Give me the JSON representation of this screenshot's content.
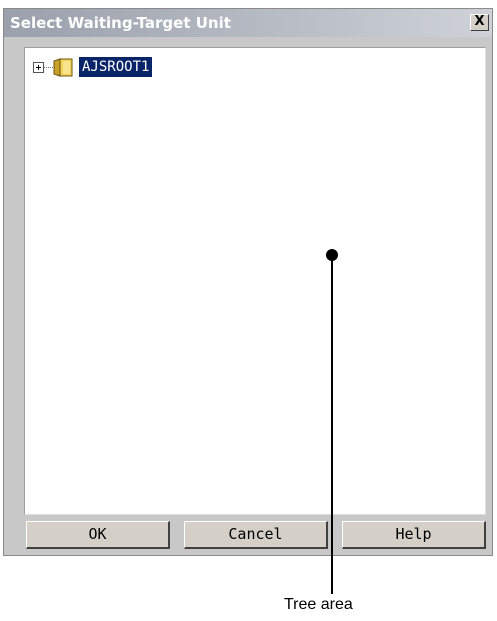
{
  "dialog": {
    "title": "Select Waiting-Target Unit",
    "close_label": "X"
  },
  "tree": {
    "nodes": [
      {
        "label": "AJSROOT1",
        "icon": "folder-icon",
        "expander": "plus",
        "selected": true
      }
    ]
  },
  "buttons": {
    "ok": "OK",
    "cancel": "Cancel",
    "help": "Help"
  },
  "annotation": {
    "label": "Tree area"
  },
  "colors": {
    "selection_bg": "#0a246a",
    "selection_text": "#ffffff",
    "dialog_bg": "#c8c8c8",
    "folder_yellow": "#e8c43a"
  }
}
